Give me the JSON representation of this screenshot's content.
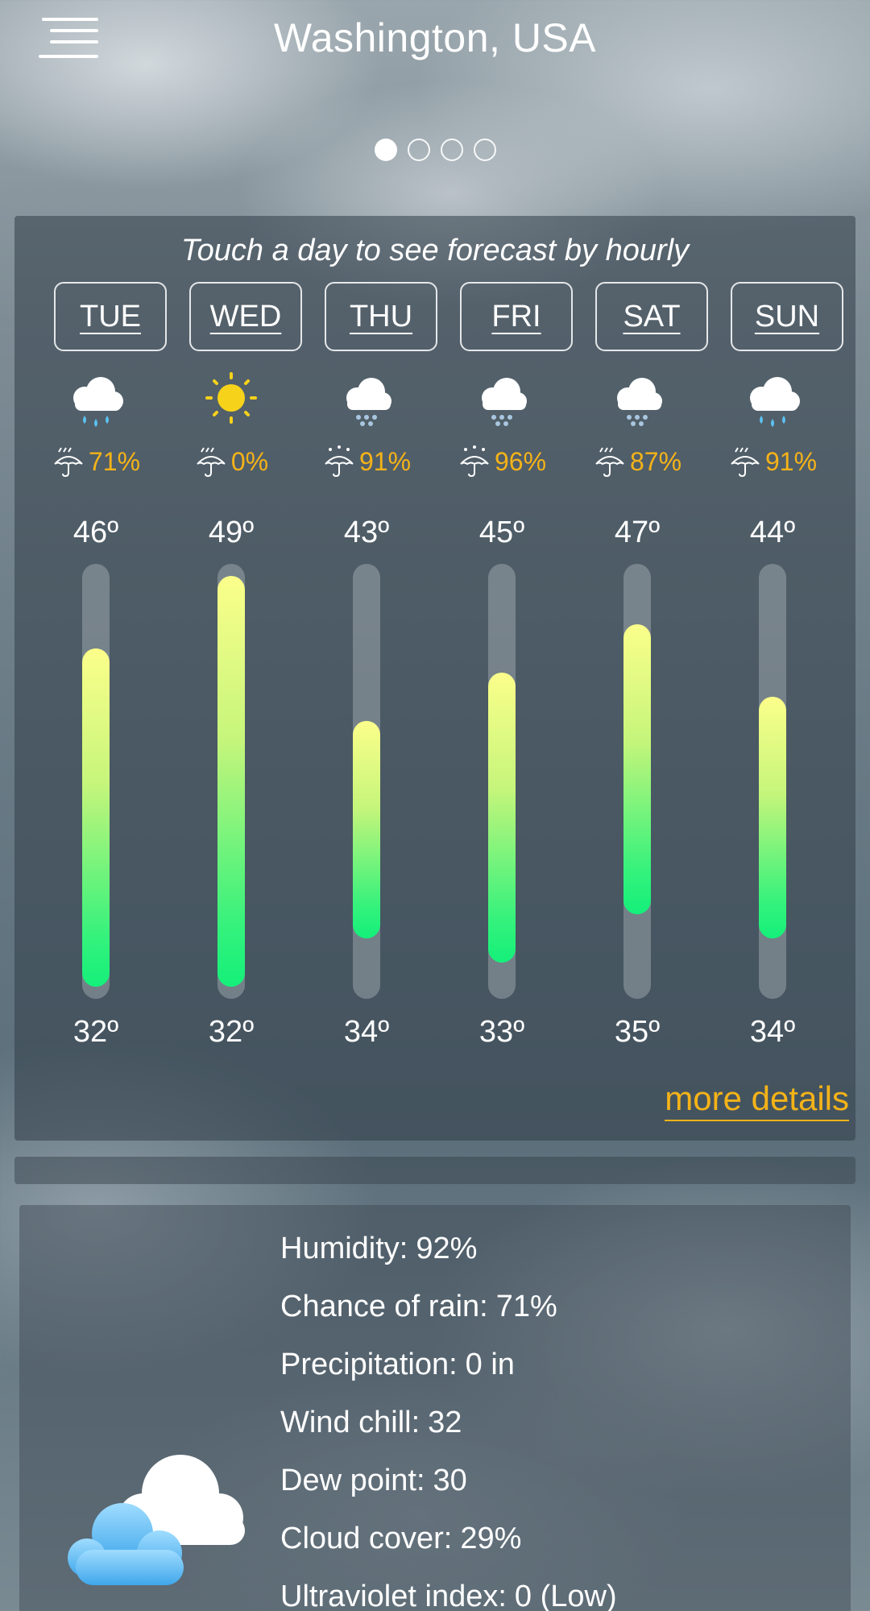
{
  "header": {
    "city": "Washington, USA",
    "menu_icon": "hamburger-menu-icon"
  },
  "pager": {
    "count": 4,
    "active": 0
  },
  "forecast": {
    "hint": "Touch a day to see forecast by hourly",
    "days": [
      {
        "label": "TUE",
        "icon": "rain-icon",
        "rain_chance": "71%",
        "high": "46º",
        "low": "32º"
      },
      {
        "label": "WED",
        "icon": "sun-icon",
        "rain_chance": "0%",
        "high": "49º",
        "low": "32º"
      },
      {
        "label": "THU",
        "icon": "snow-icon",
        "rain_chance": "91%",
        "high": "43º",
        "low": "34º"
      },
      {
        "label": "FRI",
        "icon": "snow-icon",
        "rain_chance": "96%",
        "high": "45º",
        "low": "33º"
      },
      {
        "label": "SAT",
        "icon": "snow-icon",
        "rain_chance": "87%",
        "high": "47º",
        "low": "35º"
      },
      {
        "label": "SUN",
        "icon": "rain-icon",
        "rain_chance": "91%",
        "high": "44º",
        "low": "34º"
      }
    ],
    "more_details": "more details",
    "accent_color": "#f5b318"
  },
  "details": {
    "icon": "partly-cloudy-icon",
    "rows": [
      {
        "label": "Humidity:",
        "value": "92%"
      },
      {
        "label": "Chance of rain:",
        "value": "71%"
      },
      {
        "label": "Precipitation:",
        "value": "0 in"
      },
      {
        "label": "Wind chill:",
        "value": "32"
      },
      {
        "label": "Dew point:",
        "value": "30"
      },
      {
        "label": "Cloud cover:",
        "value": "29%"
      },
      {
        "label": "Ultraviolet index:",
        "value": "0 (Low)"
      }
    ]
  }
}
